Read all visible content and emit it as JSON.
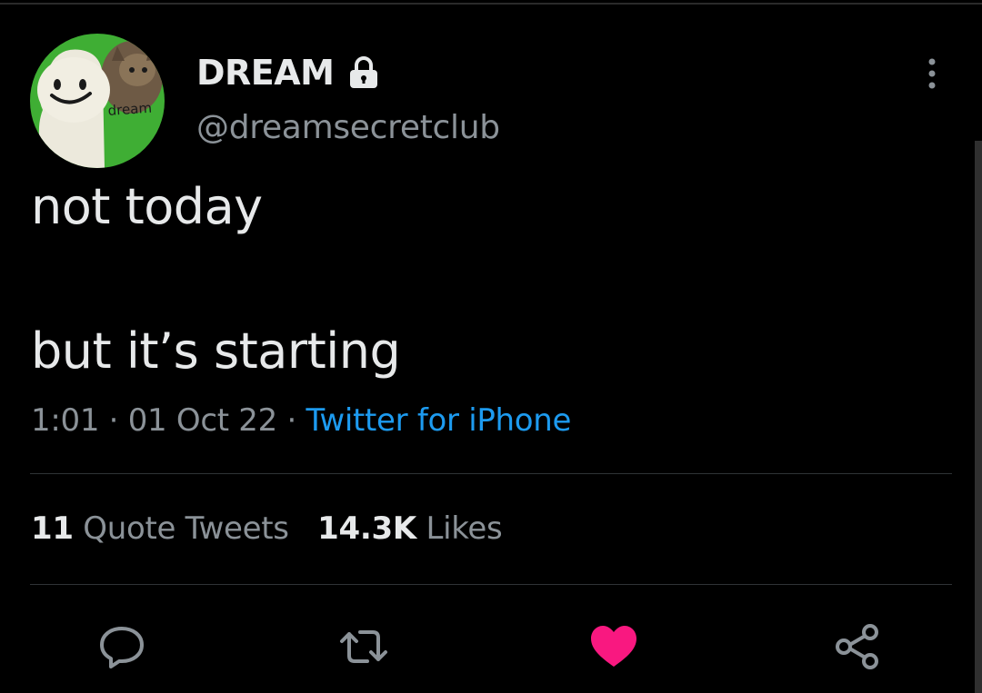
{
  "author": {
    "name": "DREAM",
    "handle": "@dreamsecretclub",
    "avatar_text": "dream"
  },
  "tweet": {
    "line1": "not today",
    "line2": "but it’s starting",
    "time": "1:01",
    "date": "01 Oct 22",
    "separator": "·",
    "source": "Twitter for iPhone"
  },
  "stats": {
    "quote_count": "11",
    "quote_label": "Quote Tweets",
    "like_count": "14.3K",
    "like_label": "Likes"
  },
  "actions": {
    "reply_icon": "reply-icon",
    "retweet_icon": "retweet-icon",
    "like_icon": "heart-icon",
    "share_icon": "share-icon",
    "like_color": "#f91880"
  },
  "colors": {
    "background": "#000000",
    "text": "#e7e9ea",
    "secondary": "#8b9298",
    "link": "#1d9bf0"
  }
}
